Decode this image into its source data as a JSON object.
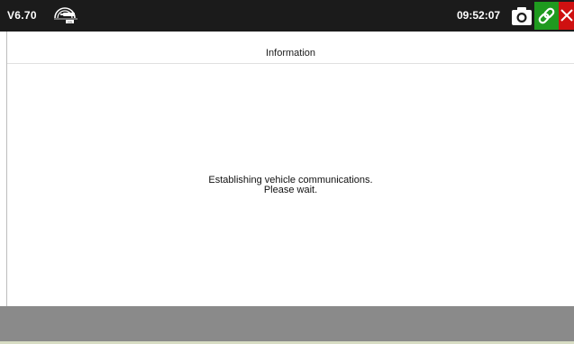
{
  "statusbar": {
    "version": "V6.70",
    "time": "09:52:07",
    "icons": [
      "vci-connection-icon",
      "camera-icon",
      "link-icon",
      "close-icon"
    ],
    "colors": {
      "background": "#1b1b1b",
      "link_button": "#1f9a1f",
      "close_button": "#cf1111"
    }
  },
  "header": {
    "title": "Information"
  },
  "main": {
    "message_line1": "Establishing vehicle communications.",
    "message_line2": "Please wait."
  },
  "footer": {
    "color": "#8a8a8a"
  }
}
